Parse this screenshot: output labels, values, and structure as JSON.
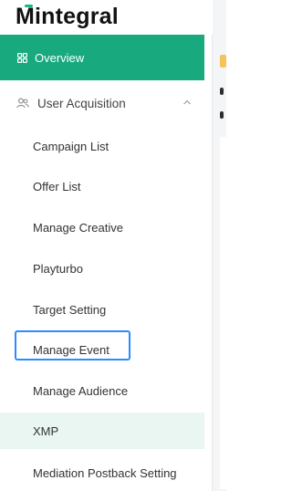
{
  "brand": {
    "name": "Mintegral",
    "accent": "#18a97e"
  },
  "sidebar": {
    "overview": {
      "label": "Overview",
      "icon": "dashboard-grid-icon"
    },
    "group": {
      "label": "User Acquisition",
      "icon": "users-icon",
      "expanded": true
    },
    "items": [
      {
        "label": "Campaign List"
      },
      {
        "label": "Offer List"
      },
      {
        "label": "Manage Creative"
      },
      {
        "label": "Playturbo"
      },
      {
        "label": "Target Setting"
      },
      {
        "label": "Manage Event"
      },
      {
        "label": "Manage Audience"
      },
      {
        "label": "XMP"
      },
      {
        "label": "Mediation Postback Setting"
      }
    ]
  }
}
